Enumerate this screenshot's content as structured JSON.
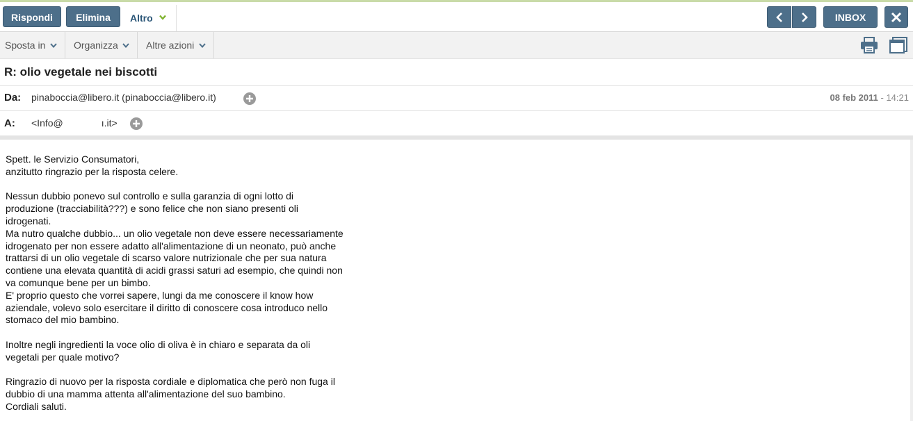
{
  "toolbar": {
    "reply_label": "Rispondi",
    "delete_label": "Elimina",
    "more_label": "Altro",
    "inbox_label": "INBOX"
  },
  "actions": {
    "move_label": "Sposta in",
    "organize_label": "Organizza",
    "other_label": "Altre azioni"
  },
  "icons": {
    "more": "chevron-down-icon",
    "prev": "chevron-left-icon",
    "next": "chevron-right-icon",
    "close": "close-icon",
    "print": "printer-icon",
    "popout": "window-icon",
    "add_contact": "plus-circle-icon"
  },
  "colors": {
    "button": "#4d6f8a",
    "link": "#2c5778",
    "accent": "#7fb32e"
  },
  "message": {
    "subject": "R: olio vegetale nei biscotti",
    "from_label": "Da:",
    "from": "pinaboccia@libero.it (pinaboccia@libero.it)",
    "to_label": "A:",
    "to_prefix": "<Info@",
    "to_suffix": "ı.it>",
    "date": "08 feb 2011",
    "date_sep": " - ",
    "time": "14:21",
    "body": [
      [
        "Spett. le Servizio Consumatori,",
        "anzitutto ringrazio per la risposta celere."
      ],
      [
        "Nessun dubbio ponevo sul controllo e sulla garanzia di ogni lotto di",
        "produzione (tracciabilità???) e sono felice che non siano presenti oli",
        "idrogenati.",
        "Ma nutro qualche dubbio... un olio vegetale non deve essere necessariamente",
        "idrogenato per non essere adatto all'alimentazione di un neonato, può anche",
        "trattarsi di un olio vegetale di scarso valore nutrizionale che per sua natura",
        "contiene una elevata quantità di acidi grassi saturi ad esempio, che quindi non",
        "va comunque bene per un bimbo.",
        "E' proprio questo che vorrei sapere, lungi da me conoscere il know how",
        "aziendale, volevo solo esercitare il diritto di conoscere cosa introduco nello",
        "stomaco del mio bambino."
      ],
      [
        "Inoltre negli ingredienti la voce olio di oliva è in chiaro e separata da oli",
        "vegetali per quale motivo?"
      ],
      [
        "Ringrazio di nuovo per la risposta cordiale e diplomatica che però non fuga il",
        "dubbio di una mamma attenta all'alimentazione del suo bambino.",
        "Cordiali saluti."
      ]
    ]
  }
}
